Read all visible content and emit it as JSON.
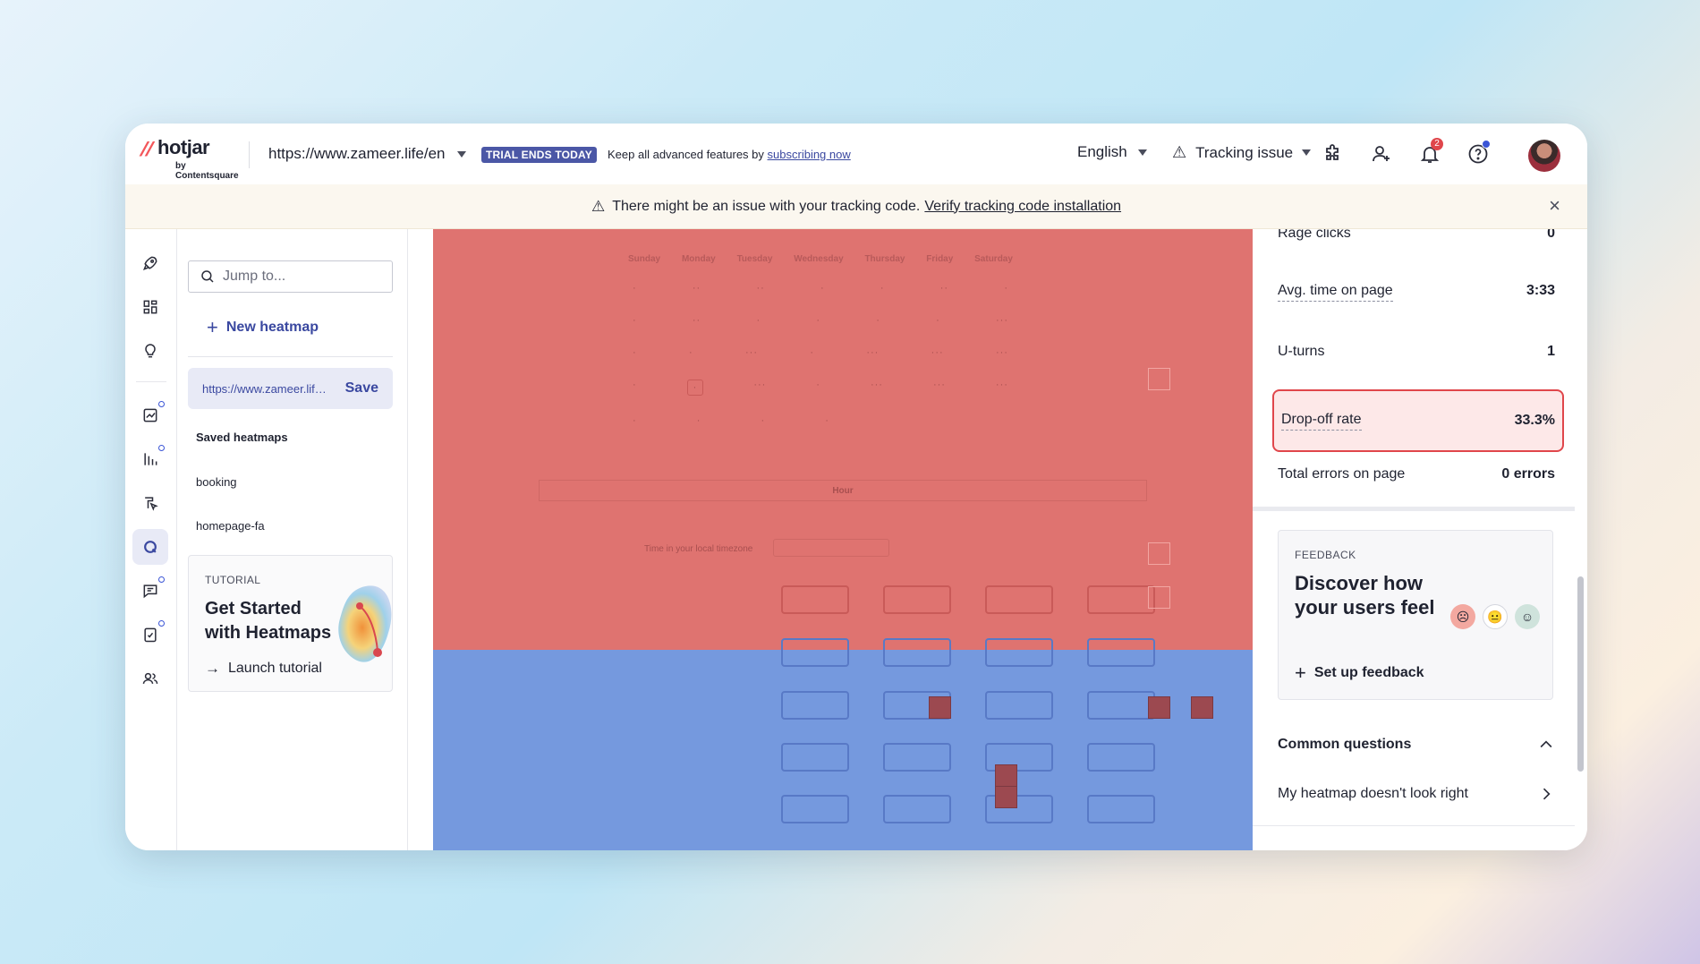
{
  "topbar": {
    "logo_name": "hotjar",
    "logo_by": "by Contentsquare",
    "site_url": "https://www.zameer.life/en",
    "trial_badge": "TRIAL ENDS TODAY",
    "trial_text": "Keep all advanced features by",
    "trial_link": "subscribing now",
    "language": "English",
    "tracking": "Tracking issue",
    "notifications_count": "2"
  },
  "banner": {
    "text": "There might be an issue with your tracking code.",
    "link": "Verify tracking code installation",
    "close": "×"
  },
  "sidebar": {
    "search_placeholder": "Jump to...",
    "new_heatmap": "New heatmap",
    "current_url": "https://www.zameer.life/en",
    "save": "Save",
    "saved_title": "Saved heatmaps",
    "saved_items": [
      "booking",
      "homepage-fa"
    ],
    "tutorial": {
      "label": "TUTORIAL",
      "title": "Get Started with Heatmaps",
      "action": "Launch tutorial"
    }
  },
  "heatmap": {
    "days": [
      "Sunday",
      "Monday",
      "Tuesday",
      "Wednesday",
      "Thursday",
      "Friday",
      "Saturday"
    ],
    "hour_label": "Hour",
    "tz_label": "Time in your local timezone"
  },
  "metrics": {
    "rage_clicks": {
      "label": "Rage clicks",
      "value": "0"
    },
    "avg_time": {
      "label": "Avg. time on page",
      "value": "3:33"
    },
    "u_turns": {
      "label": "U-turns",
      "value": "1"
    },
    "drop_off": {
      "label": "Drop-off rate",
      "value": "33.3%"
    },
    "errors": {
      "label": "Total errors on page",
      "value": "0 errors"
    }
  },
  "feedback": {
    "label": "FEEDBACK",
    "title": "Discover how your users feel",
    "action": "Set up feedback"
  },
  "questions": {
    "title": "Common questions",
    "items": [
      "My heatmap doesn't look right"
    ]
  },
  "colors": {
    "heat_red": "#df7370",
    "heat_blue": "#7599de",
    "accent": "#3a48a0",
    "alert": "#e0464b"
  }
}
